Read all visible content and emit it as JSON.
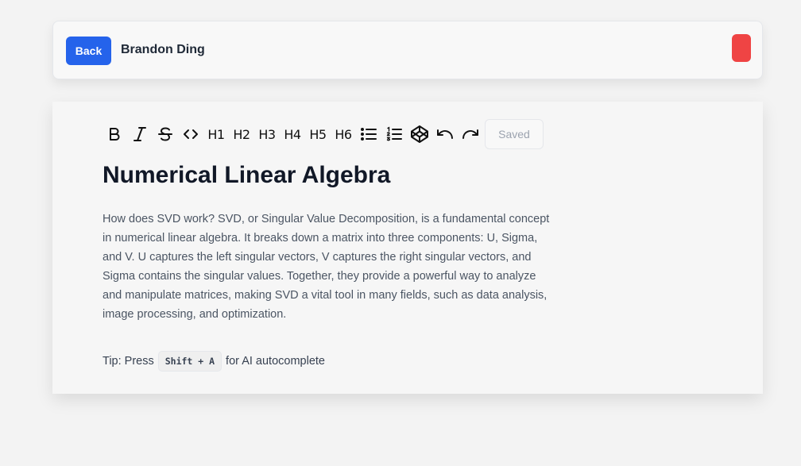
{
  "header": {
    "back_label": "Back",
    "user_name": "Brandon Ding",
    "accent_color": "#2563eb",
    "danger_color": "#ef4444"
  },
  "toolbar": {
    "buttons": [
      {
        "icon": "bold-icon"
      },
      {
        "icon": "italic-icon"
      },
      {
        "icon": "strikethrough-icon"
      },
      {
        "icon": "code-icon"
      },
      {
        "icon": "heading-1-icon",
        "label": "H1"
      },
      {
        "icon": "heading-2-icon",
        "label": "H2"
      },
      {
        "icon": "heading-3-icon",
        "label": "H3"
      },
      {
        "icon": "heading-4-icon",
        "label": "H4"
      },
      {
        "icon": "heading-5-icon",
        "label": "H5"
      },
      {
        "icon": "heading-6-icon",
        "label": "H6"
      },
      {
        "icon": "bullet-list-icon"
      },
      {
        "icon": "ordered-list-icon"
      },
      {
        "icon": "codepen-icon"
      },
      {
        "icon": "undo-icon"
      },
      {
        "icon": "redo-icon"
      }
    ],
    "status": "Saved"
  },
  "document": {
    "title": "Numerical Linear Algebra",
    "body": "How does SVD work? SVD, or Singular Value Decomposition, is a fundamental concept in numerical linear algebra. It breaks down a matrix into three components: U, Sigma, and V. U captures the left singular vectors, V captures the right singular vectors, and Sigma contains the singular values. Together, they provide a powerful way to analyze and manipulate matrices, making SVD a vital tool in many fields, such as data analysis, image processing, and optimization."
  },
  "tip": {
    "prefix": "Tip: Press",
    "shortcut": "Shift + A",
    "suffix": "for AI autocomplete"
  }
}
